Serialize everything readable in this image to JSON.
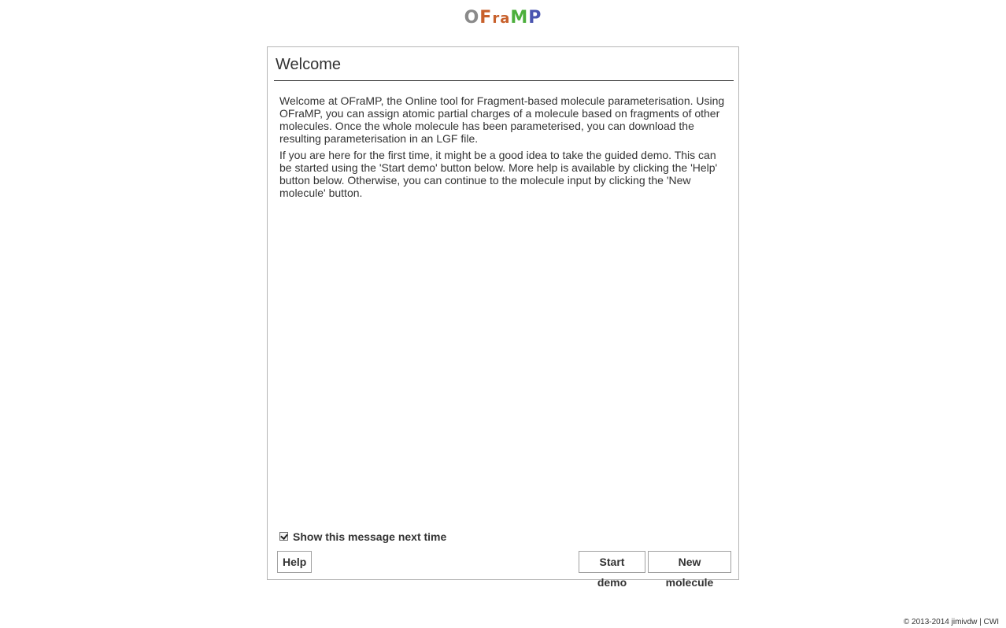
{
  "logo": {
    "letters": [
      "O",
      "F",
      "r",
      "a",
      "M",
      "P"
    ],
    "colors": [
      "#8a8a8a",
      "#c8612c",
      "#c8612c",
      "#c8612c",
      "#4caf3c",
      "#4a55b0"
    ]
  },
  "dialog": {
    "title": "Welcome",
    "paragraphs": [
      "Welcome at OFraMP, the Online tool for Fragment-based molecule parameterisation. Using OFraMP, you can assign atomic partial charges of a molecule based on fragments of other molecules. Once the whole molecule has been parameterised, you can download the resulting parameterisation in an LGF file.",
      "If you are here for the first time, it might be a good idea to take the guided demo. This can be started using the 'Start demo' button below. More help is available by clicking the 'Help' button below. Otherwise, you can continue to the molecule input by clicking the 'New molecule' button."
    ],
    "show_checkbox": {
      "label": "Show this message next time",
      "checked": true
    },
    "buttons": {
      "help": "Help",
      "start_demo": "Start demo",
      "new_molecule": "New molecule"
    }
  },
  "footer": {
    "text": "© 2013-2014 jimivdw | CWI"
  }
}
